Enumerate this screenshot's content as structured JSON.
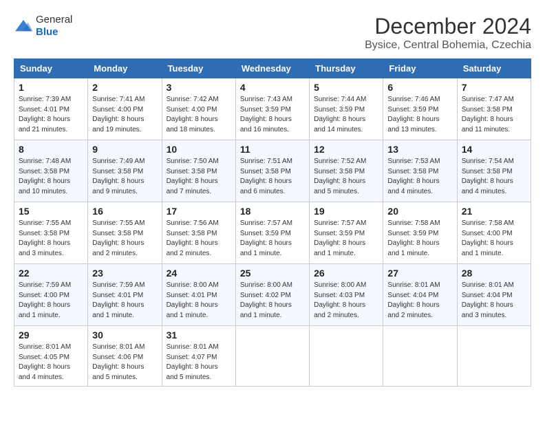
{
  "header": {
    "logo_general": "General",
    "logo_blue": "Blue",
    "month_title": "December 2024",
    "location": "Bysice, Central Bohemia, Czechia"
  },
  "weekdays": [
    "Sunday",
    "Monday",
    "Tuesday",
    "Wednesday",
    "Thursday",
    "Friday",
    "Saturday"
  ],
  "weeks": [
    [
      {
        "day": "1",
        "sunrise": "7:39 AM",
        "sunset": "4:01 PM",
        "daylight": "8 hours and 21 minutes."
      },
      {
        "day": "2",
        "sunrise": "7:41 AM",
        "sunset": "4:00 PM",
        "daylight": "8 hours and 19 minutes."
      },
      {
        "day": "3",
        "sunrise": "7:42 AM",
        "sunset": "4:00 PM",
        "daylight": "8 hours and 18 minutes."
      },
      {
        "day": "4",
        "sunrise": "7:43 AM",
        "sunset": "3:59 PM",
        "daylight": "8 hours and 16 minutes."
      },
      {
        "day": "5",
        "sunrise": "7:44 AM",
        "sunset": "3:59 PM",
        "daylight": "8 hours and 14 minutes."
      },
      {
        "day": "6",
        "sunrise": "7:46 AM",
        "sunset": "3:59 PM",
        "daylight": "8 hours and 13 minutes."
      },
      {
        "day": "7",
        "sunrise": "7:47 AM",
        "sunset": "3:58 PM",
        "daylight": "8 hours and 11 minutes."
      }
    ],
    [
      {
        "day": "8",
        "sunrise": "7:48 AM",
        "sunset": "3:58 PM",
        "daylight": "8 hours and 10 minutes."
      },
      {
        "day": "9",
        "sunrise": "7:49 AM",
        "sunset": "3:58 PM",
        "daylight": "8 hours and 9 minutes."
      },
      {
        "day": "10",
        "sunrise": "7:50 AM",
        "sunset": "3:58 PM",
        "daylight": "8 hours and 7 minutes."
      },
      {
        "day": "11",
        "sunrise": "7:51 AM",
        "sunset": "3:58 PM",
        "daylight": "8 hours and 6 minutes."
      },
      {
        "day": "12",
        "sunrise": "7:52 AM",
        "sunset": "3:58 PM",
        "daylight": "8 hours and 5 minutes."
      },
      {
        "day": "13",
        "sunrise": "7:53 AM",
        "sunset": "3:58 PM",
        "daylight": "8 hours and 4 minutes."
      },
      {
        "day": "14",
        "sunrise": "7:54 AM",
        "sunset": "3:58 PM",
        "daylight": "8 hours and 4 minutes."
      }
    ],
    [
      {
        "day": "15",
        "sunrise": "7:55 AM",
        "sunset": "3:58 PM",
        "daylight": "8 hours and 3 minutes."
      },
      {
        "day": "16",
        "sunrise": "7:55 AM",
        "sunset": "3:58 PM",
        "daylight": "8 hours and 2 minutes."
      },
      {
        "day": "17",
        "sunrise": "7:56 AM",
        "sunset": "3:58 PM",
        "daylight": "8 hours and 2 minutes."
      },
      {
        "day": "18",
        "sunrise": "7:57 AM",
        "sunset": "3:59 PM",
        "daylight": "8 hours and 1 minute."
      },
      {
        "day": "19",
        "sunrise": "7:57 AM",
        "sunset": "3:59 PM",
        "daylight": "8 hours and 1 minute."
      },
      {
        "day": "20",
        "sunrise": "7:58 AM",
        "sunset": "3:59 PM",
        "daylight": "8 hours and 1 minute."
      },
      {
        "day": "21",
        "sunrise": "7:58 AM",
        "sunset": "4:00 PM",
        "daylight": "8 hours and 1 minute."
      }
    ],
    [
      {
        "day": "22",
        "sunrise": "7:59 AM",
        "sunset": "4:00 PM",
        "daylight": "8 hours and 1 minute."
      },
      {
        "day": "23",
        "sunrise": "7:59 AM",
        "sunset": "4:01 PM",
        "daylight": "8 hours and 1 minute."
      },
      {
        "day": "24",
        "sunrise": "8:00 AM",
        "sunset": "4:01 PM",
        "daylight": "8 hours and 1 minute."
      },
      {
        "day": "25",
        "sunrise": "8:00 AM",
        "sunset": "4:02 PM",
        "daylight": "8 hours and 1 minute."
      },
      {
        "day": "26",
        "sunrise": "8:00 AM",
        "sunset": "4:03 PM",
        "daylight": "8 hours and 2 minutes."
      },
      {
        "day": "27",
        "sunrise": "8:01 AM",
        "sunset": "4:04 PM",
        "daylight": "8 hours and 2 minutes."
      },
      {
        "day": "28",
        "sunrise": "8:01 AM",
        "sunset": "4:04 PM",
        "daylight": "8 hours and 3 minutes."
      }
    ],
    [
      {
        "day": "29",
        "sunrise": "8:01 AM",
        "sunset": "4:05 PM",
        "daylight": "8 hours and 4 minutes."
      },
      {
        "day": "30",
        "sunrise": "8:01 AM",
        "sunset": "4:06 PM",
        "daylight": "8 hours and 5 minutes."
      },
      {
        "day": "31",
        "sunrise": "8:01 AM",
        "sunset": "4:07 PM",
        "daylight": "8 hours and 5 minutes."
      },
      null,
      null,
      null,
      null
    ]
  ]
}
